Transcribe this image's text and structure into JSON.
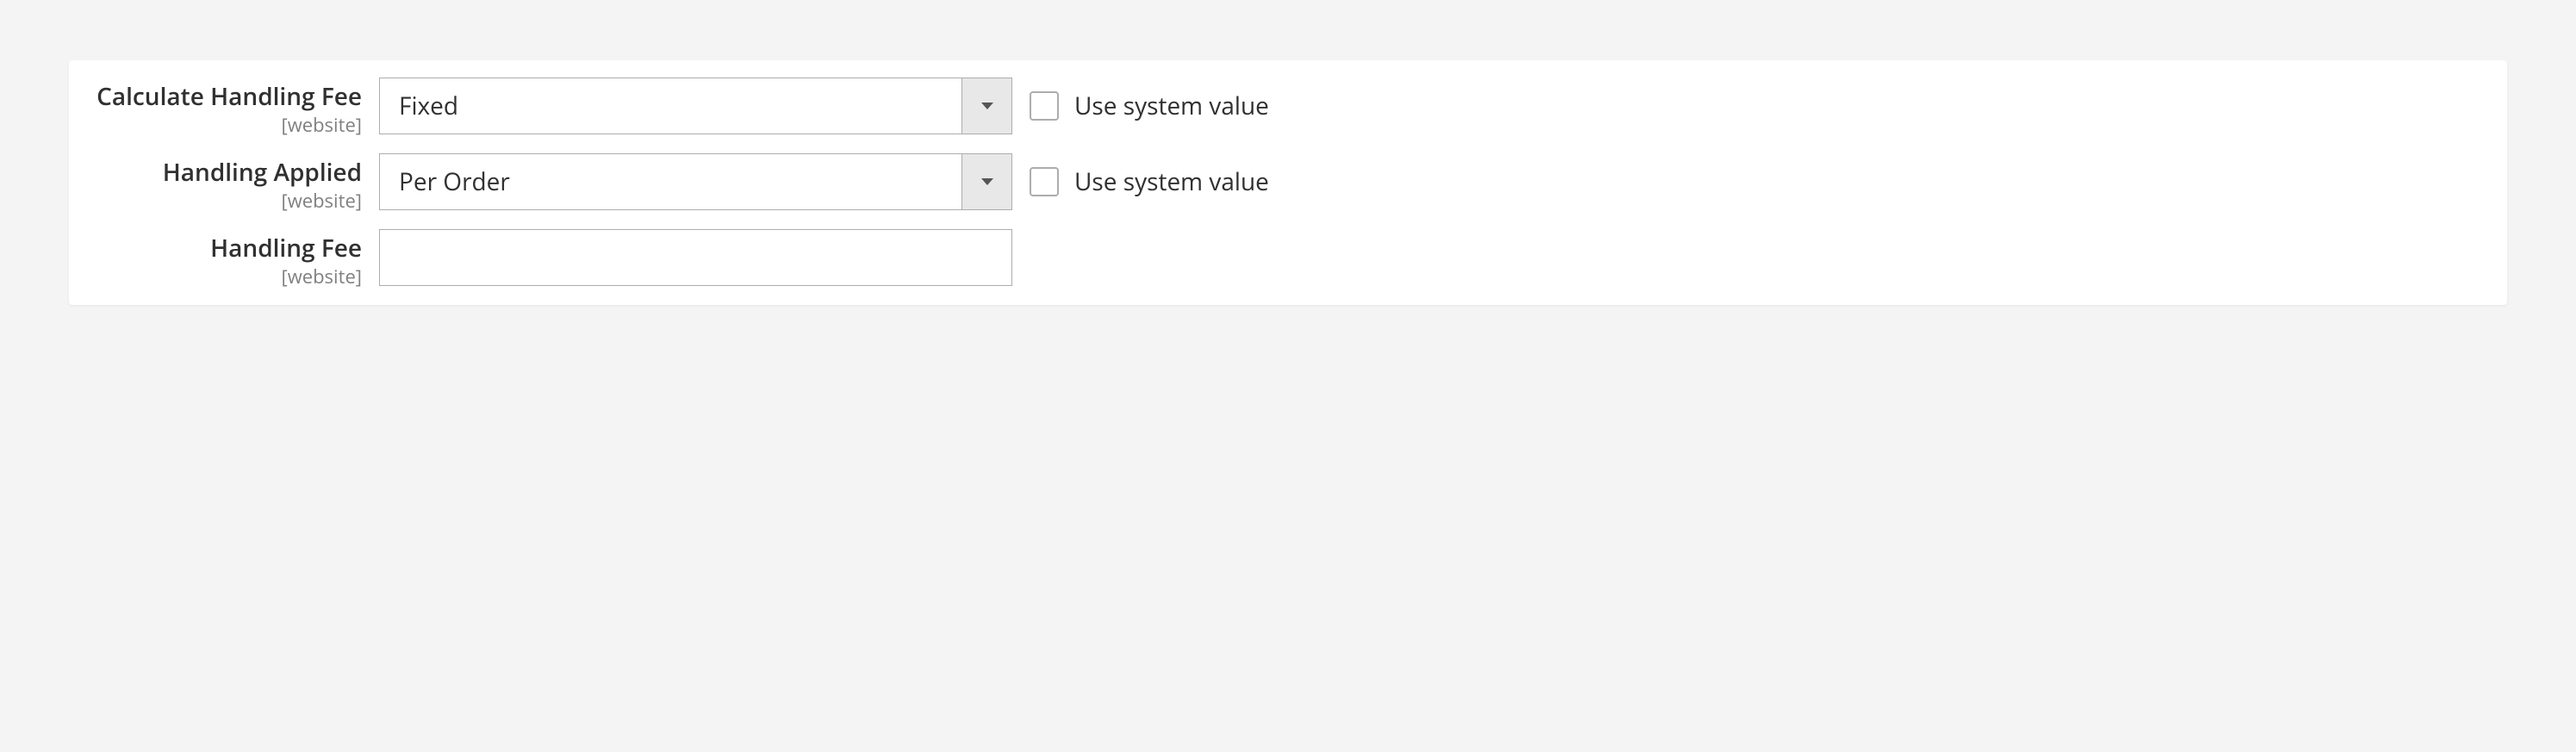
{
  "fields": {
    "calculate_handling_fee": {
      "label": "Calculate Handling Fee",
      "scope": "[website]",
      "value": "Fixed",
      "use_system_label": "Use system value"
    },
    "handling_applied": {
      "label": "Handling Applied",
      "scope": "[website]",
      "value": "Per Order",
      "use_system_label": "Use system value"
    },
    "handling_fee": {
      "label": "Handling Fee",
      "scope": "[website]",
      "value": ""
    }
  }
}
